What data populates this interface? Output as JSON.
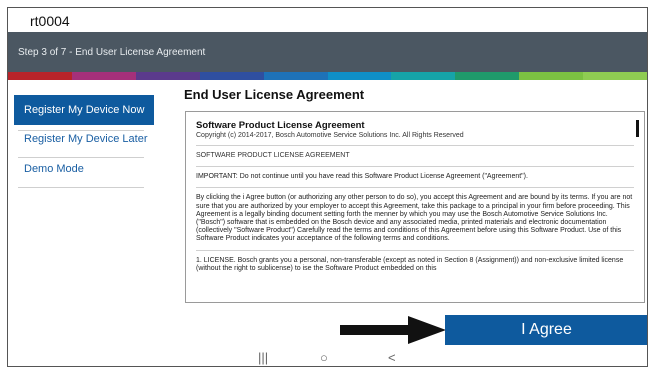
{
  "window": {
    "title": "rt0004"
  },
  "step": {
    "text": "Step 3 of 7 - End User License Agreement"
  },
  "supergraphic_colors": [
    "#b8242a",
    "#a5307a",
    "#5b3a8c",
    "#2f4fa0",
    "#1e72b8",
    "#0f8fc6",
    "#16a3a8",
    "#1f9a6b",
    "#7cc142",
    "#8fcc52"
  ],
  "sidebar": {
    "items": [
      {
        "label": "Register My Device Now",
        "active": true
      },
      {
        "label": "Register My Device Later",
        "active": false
      },
      {
        "label": "Demo Mode",
        "active": false
      }
    ]
  },
  "main": {
    "title": "End User License Agreement"
  },
  "license": {
    "heading": "Software Product License Agreement",
    "copyright": "Copyright (c) 2014-2017, Bosch Automotive Service Solutions Inc. All Rights Reserved",
    "caps_title": "SOFTWARE PRODUCT LICENSE AGREEMENT",
    "important": "IMPORTANT: Do not continue until you have read this Software Product License Agreement (\"Agreement\").",
    "para1": "By clicking the i Agree button (or authorizing any other person to do so), you accept this Agreement and are bound by its terms. If you are not sure that you are authorized by your employer to accept this Agreement, take this package to a principal in your firm before proceeding. This Agreement is a legally binding document setting forth the menner by which you may use the Bosch Automotive Service Solutions Inc. (\"Bosch\") software that is embedded on the Bosch device and any associated media, printed materials and electronic documentation (collectively \"Software Product\") Carefully read the terms and conditions of this Agreement before using this Software Product. Use of this Software Product indicates your acceptance of the following terms and conditions.",
    "para2": "1. LICENSE. Bosch grants you a personal, non-transferable (except as noted in Section 8 (Assignment)) and non-exclusive limited license (without the right to sublicense) to ise the Software Product embedded on this"
  },
  "actions": {
    "agree_label": "I Agree"
  },
  "nav": {
    "recents": "|||",
    "home": "○",
    "back": "<"
  }
}
